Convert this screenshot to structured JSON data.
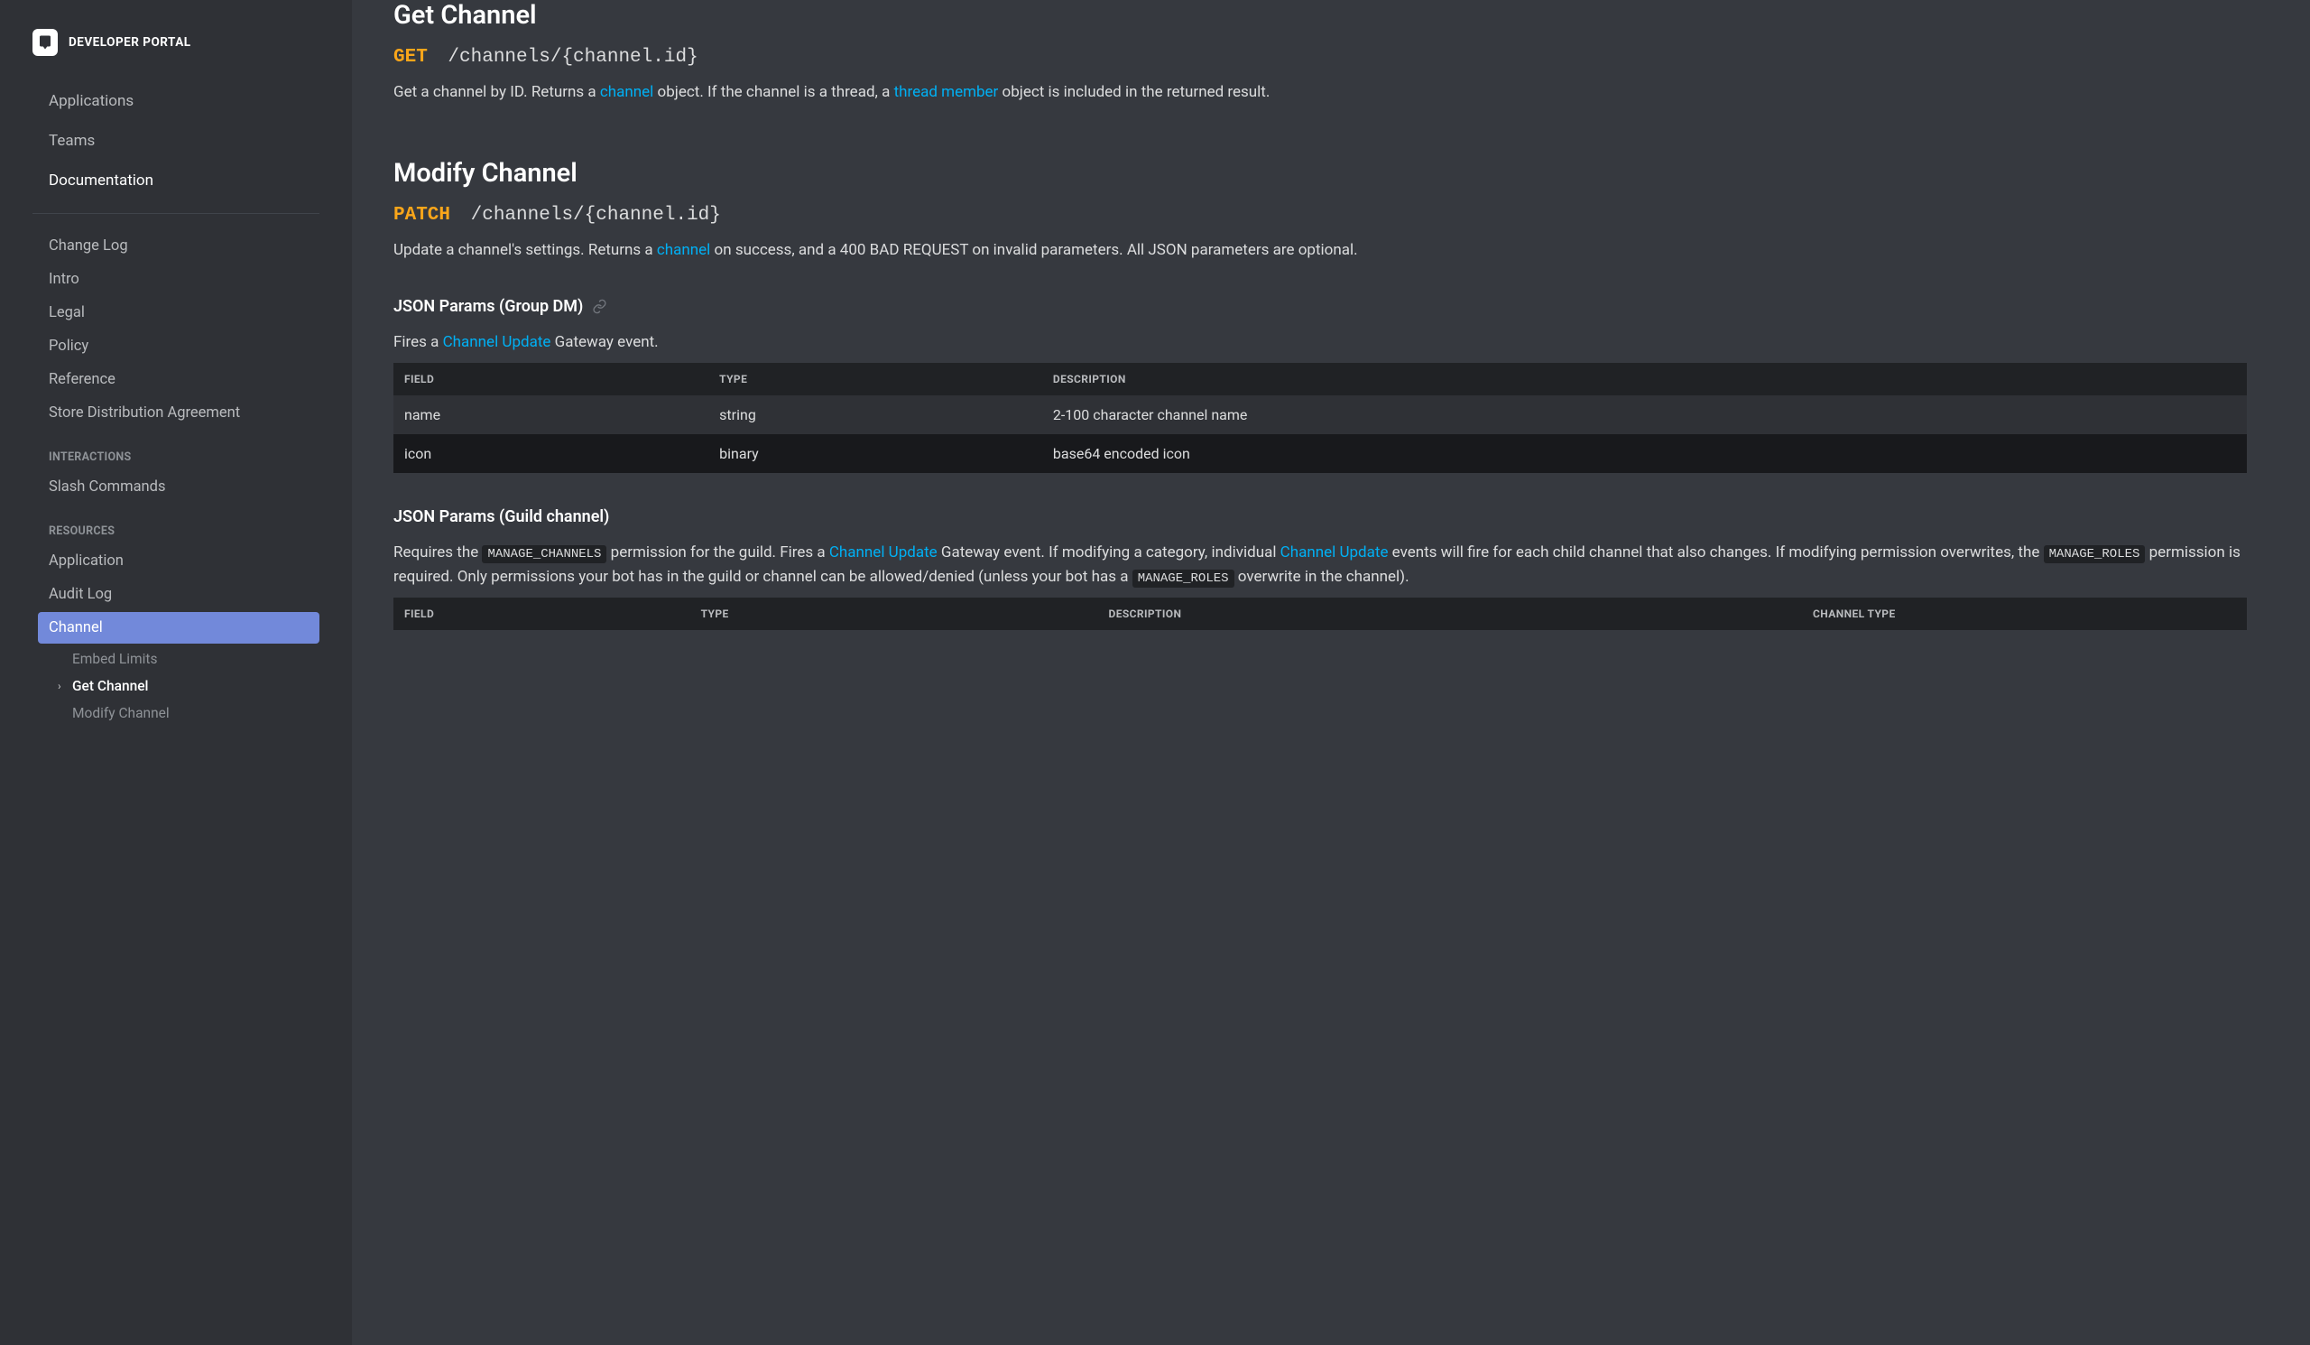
{
  "brand": {
    "title": "DEVELOPER PORTAL"
  },
  "top_nav": {
    "applications": "Applications",
    "teams": "Teams",
    "documentation": "Documentation"
  },
  "nav": {
    "change_log": "Change Log",
    "intro": "Intro",
    "legal": "Legal",
    "policy": "Policy",
    "reference": "Reference",
    "store_dist": "Store Distribution Agreement",
    "heading_interactions": "INTERACTIONS",
    "slash_commands": "Slash Commands",
    "heading_resources": "RESOURCES",
    "application": "Application",
    "audit_log": "Audit Log",
    "channel": "Channel",
    "sub": {
      "embed_limits": "Embed Limits",
      "get_channel": "Get Channel",
      "modify_channel": "Modify Channel"
    }
  },
  "get_channel": {
    "title": "Get Channel",
    "method": "GET",
    "path": "/channels/{channel.id}",
    "desc_1": "Get a channel by ID. Returns a ",
    "link_channel": "channel",
    "desc_2": " object. If the channel is a thread, a ",
    "link_thread_member": "thread member",
    "desc_3": " object is included in the returned result."
  },
  "modify_channel": {
    "title": "Modify Channel",
    "method": "PATCH",
    "path": "/channels/{channel.id}",
    "desc_1": "Update a channel's settings. Returns a ",
    "link_channel": "channel",
    "desc_2": " on success, and a 400 BAD REQUEST on invalid parameters. All JSON parameters are optional.",
    "group_dm": {
      "heading": "JSON Params (Group DM)",
      "fires": "Fires a ",
      "link": "Channel Update",
      "fires_2": " Gateway event.",
      "headers": {
        "field": "FIELD",
        "type": "TYPE",
        "desc": "DESCRIPTION"
      },
      "rows": [
        {
          "field": "name",
          "type": "string",
          "desc": "2-100 character channel name"
        },
        {
          "field": "icon",
          "type": "binary",
          "desc": "base64 encoded icon"
        }
      ]
    },
    "guild": {
      "heading": "JSON Params (Guild channel)",
      "p1_a": "Requires the ",
      "perm_manage_channels": "MANAGE_CHANNELS",
      "p1_b": " permission for the guild. Fires a ",
      "link1": "Channel Update",
      "p1_c": " Gateway event. If modifying a category, individual ",
      "link2": "Channel Update",
      "p1_d": " events will fire for each child channel that also changes. If modifying permission overwrites, the ",
      "perm_manage_roles_1": "MANAGE_ROLES",
      "p1_e": " permission is required. Only permissions your bot has in the guild or channel can be allowed/denied (unless your bot has a ",
      "perm_manage_roles_2": "MANAGE_ROLES",
      "p1_f": " overwrite in the channel).",
      "headers": {
        "field": "FIELD",
        "type": "TYPE",
        "desc": "DESCRIPTION",
        "ctype": "CHANNEL TYPE"
      }
    }
  }
}
